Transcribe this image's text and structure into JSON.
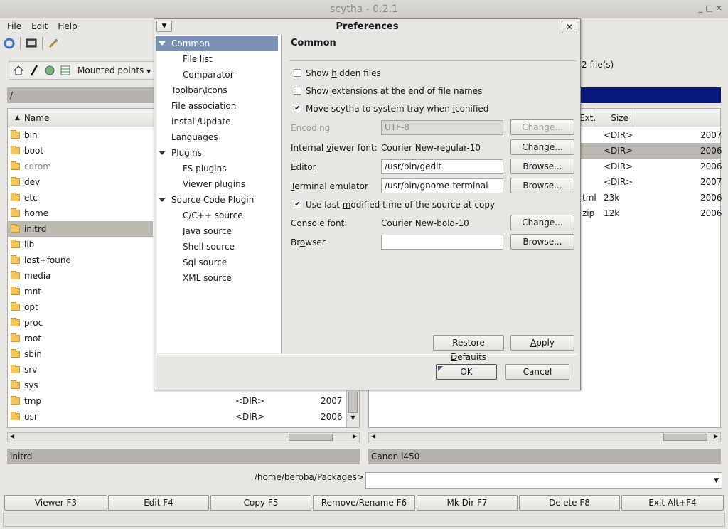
{
  "window": {
    "title": "scytha - 0.2.1"
  },
  "menu": {
    "file": "File",
    "edit": "Edit",
    "help": "Help"
  },
  "nav": {
    "mounted": "Mounted points"
  },
  "left_panel": {
    "path": "/",
    "header_name": "Name",
    "rows": [
      {
        "name": "bin"
      },
      {
        "name": "boot"
      },
      {
        "name": "cdrom"
      },
      {
        "name": "dev"
      },
      {
        "name": "etc"
      },
      {
        "name": "home"
      },
      {
        "name": "initrd"
      },
      {
        "name": "lib"
      },
      {
        "name": "lost+found"
      },
      {
        "name": "media"
      },
      {
        "name": "mnt"
      },
      {
        "name": "opt"
      },
      {
        "name": "proc"
      },
      {
        "name": "root"
      },
      {
        "name": "sbin"
      },
      {
        "name": "srv"
      },
      {
        "name": "sys"
      },
      {
        "name": "tmp",
        "size": "<DIR>",
        "date": "2007"
      },
      {
        "name": "usr",
        "size": "<DIR>",
        "date": "2006"
      }
    ],
    "status": "initrd"
  },
  "right_panel": {
    "file_count": "2 file(s)",
    "header_ext": "Ext.",
    "header_size": "Size",
    "rows": [
      {
        "ext": "",
        "size": "<DIR>",
        "date": "2007"
      },
      {
        "ext": "",
        "size": "<DIR>",
        "date": "2006"
      },
      {
        "ext": "",
        "size": "<DIR>",
        "date": "2006"
      },
      {
        "ext": "",
        "size": "<DIR>",
        "date": "2007"
      },
      {
        "ext": "tml",
        "size": "23k",
        "date": "2006"
      },
      {
        "ext": "zip",
        "size": "12k",
        "date": "2006"
      }
    ],
    "status": "Canon i450"
  },
  "command": {
    "path": "/home/beroba/Packages>",
    "value": ""
  },
  "fkeys": [
    "Viewer F3",
    "Edit F4",
    "Copy F5",
    "Remove/Rename F6",
    "Mk Dir F7",
    "Delete F8",
    "Exit Alt+F4"
  ],
  "dialog": {
    "title": "Preferences",
    "tree": {
      "common": "Common",
      "file_list": "File list",
      "comparator": "Comparator",
      "toolbar": "Toolbar\\Icons",
      "file_assoc": "File association",
      "install": "Install/Update",
      "languages": "Languages",
      "plugins": "Plugins",
      "fs_plugins": "FS plugins",
      "viewer_plugins": "Viewer plugins",
      "source_plugin": "Source Code Plugin",
      "cpp": "C/C++ source",
      "java": "Java source",
      "shell": "Shell source",
      "sql": "Sql source",
      "xml": "XML source"
    },
    "section_title": "Common",
    "opt_hidden": {
      "pre": "Show ",
      "u": "h",
      "post": "idden files",
      "checked": false
    },
    "opt_ext": {
      "pre": "Show ",
      "u": "e",
      "post": "xtensions at the end of file names",
      "checked": false
    },
    "opt_tray": {
      "pre": "Move scytha to system tray when ",
      "u": "i",
      "post": "conified",
      "checked": true
    },
    "encoding": {
      "label": "Encoding",
      "value": "UTF-8",
      "button": "Change..."
    },
    "viewer_font": {
      "pre": "Internal ",
      "u": "v",
      "post": "iewer font:",
      "value": "Courier New-regular-10",
      "button": "Change..."
    },
    "editor": {
      "pre": "Edito",
      "u": "r",
      "post": "",
      "value": "/usr/bin/gedit",
      "button": "Browse..."
    },
    "terminal": {
      "pre": "",
      "u": "T",
      "post": "erminal emulator",
      "value": "/usr/bin/gnome-terminal",
      "button": "Browse..."
    },
    "opt_modtime": {
      "pre": "Use last ",
      "u": "m",
      "post": "odified time of the source at copy",
      "checked": true
    },
    "console_font": {
      "label": "Console font:",
      "value": "Courier New-bold-10",
      "button": "Change..."
    },
    "browser": {
      "pre": "Br",
      "u": "o",
      "post": "wser",
      "value": "",
      "button": "Browse..."
    },
    "restore": {
      "pre": "Restore ",
      "u": "D",
      "post": "efaults"
    },
    "apply": {
      "pre": "",
      "u": "A",
      "post": "pply"
    },
    "ok": "OK",
    "cancel": "Cancel"
  },
  "colors": {
    "selection": "#7a91b4",
    "path_active": "#0a1a7a",
    "highlight_row": "#bdb9b2"
  }
}
